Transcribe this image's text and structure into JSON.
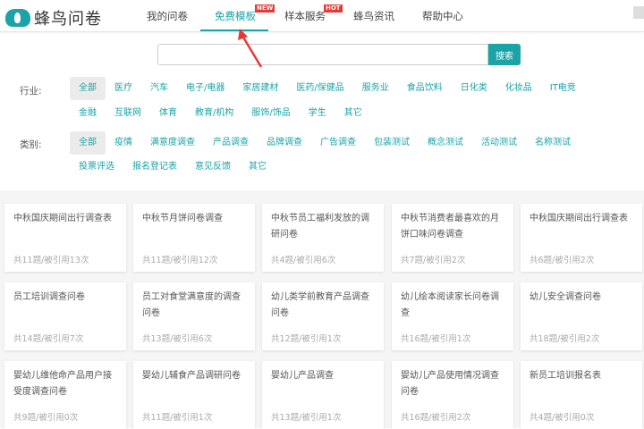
{
  "header": {
    "logo": "蜂鸟问卷",
    "nav": [
      {
        "label": "我的问卷",
        "badge": null
      },
      {
        "label": "免费模板",
        "badge": "NEW"
      },
      {
        "label": "样本服务",
        "badge": "HOT"
      },
      {
        "label": "蜂鸟资讯",
        "badge": null
      },
      {
        "label": "帮助中心",
        "badge": null
      }
    ]
  },
  "search": {
    "placeholder": "",
    "button": "搜索"
  },
  "filters": {
    "industry": {
      "label": "行业:",
      "row1": [
        "全部",
        "医疗",
        "汽车",
        "电子/电器",
        "家居建材",
        "医药/保健品",
        "服务业",
        "食品饮料",
        "日化类",
        "化妆品",
        "IT电竞"
      ],
      "row2": [
        "金融",
        "互联网",
        "体育",
        "教育/机构",
        "服饰/饰品",
        "学生",
        "其它"
      ]
    },
    "category": {
      "label": "类别:",
      "row1": [
        "全部",
        "疫情",
        "满意度调查",
        "产品调查",
        "品牌调查",
        "广告调查",
        "包装测试",
        "概念测试",
        "活动测试",
        "名称测试"
      ],
      "row2": [
        "投票评选",
        "报名登记表",
        "意见反馈",
        "其它"
      ]
    }
  },
  "cards": [
    {
      "title": "中秋国庆期间出行调查表",
      "meta": "共11题/被引用13次"
    },
    {
      "title": "中秋节月饼问卷调查",
      "meta": "共11题/被引用12次"
    },
    {
      "title": "中秋节员工福利发放的调研问卷",
      "meta": "共4题/被引用6次"
    },
    {
      "title": "中秋节消费者最喜欢的月饼口味问卷调查",
      "meta": "共7题/被引用2次"
    },
    {
      "title": "中秋国庆期间出行调查表",
      "meta": "共6题/被引用2次"
    },
    {
      "title": "员工培训调查问卷",
      "meta": "共14题/被引用7次"
    },
    {
      "title": "员工对食堂满意度的调查问卷",
      "meta": "共13题/被引用6次"
    },
    {
      "title": "幼儿类学前教育产品调查问卷",
      "meta": "共12题/被引用1次"
    },
    {
      "title": "幼儿绘本阅读家长问卷调查",
      "meta": "共16题/被引用1次"
    },
    {
      "title": "幼儿安全调查问卷",
      "meta": "共18题/被引用2次"
    },
    {
      "title": "婴幼儿维他命产品用户接受度调查问卷",
      "meta": "共9题/被引用0次"
    },
    {
      "title": "婴幼儿辅食产品调研问卷",
      "meta": "共11题/被引用1次"
    },
    {
      "title": "婴幼儿产品调查",
      "meta": "共13题/被引用1次"
    },
    {
      "title": "婴幼儿产品使用情况调查问卷",
      "meta": "共16题/被引用2次"
    },
    {
      "title": "新员工培训报名表",
      "meta": "共4题/被引用0次"
    }
  ],
  "colors": {
    "accent": "#1ba3a8",
    "badge": "#e53935",
    "arrow": "#e53935"
  }
}
